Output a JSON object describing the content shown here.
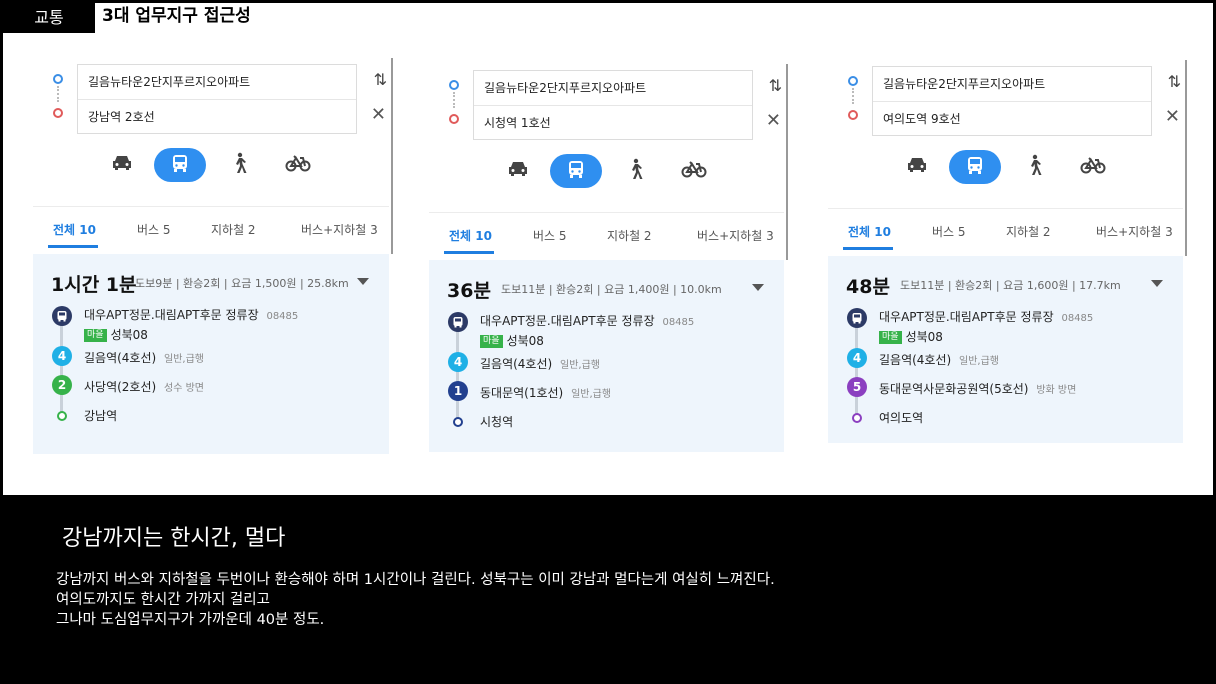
{
  "header": {
    "tag": "교통",
    "title": "3대 업무지구 접근성"
  },
  "panels": [
    {
      "origin": "길음뉴타운2단지푸르지오아파트",
      "destination": "강남역 2호선",
      "tabs": [
        "전체 10",
        "버스 5",
        "지하철 2",
        "버스+지하철 3"
      ],
      "time": "1시간 1분",
      "meta": "도보9분 | 환승2회 | 요금 1,500원 | 25.8km",
      "bus_stop": "대우APT정문.대림APT후문 정류장",
      "bus_stop_id": "08485",
      "bus_badge": "마을",
      "bus_route": "성북08",
      "legs": [
        {
          "num": "4",
          "color": "#1fb0e6",
          "station": "길음역(4호선)",
          "sub": "일반,급행"
        },
        {
          "num": "2",
          "color": "#36b24a",
          "station": "사당역(2호선)",
          "sub": "성수 방면"
        }
      ],
      "end_color": "#36b24a",
      "end_station": "강남역"
    },
    {
      "origin": "길음뉴타운2단지푸르지오아파트",
      "destination": "시청역 1호선",
      "tabs": [
        "전체 10",
        "버스 5",
        "지하철 2",
        "버스+지하철 3"
      ],
      "time": "36분",
      "meta": "도보11분 | 환승2회 | 요금 1,400원 | 10.0km",
      "bus_stop": "대우APT정문.대림APT후문 정류장",
      "bus_stop_id": "08485",
      "bus_badge": "마을",
      "bus_route": "성북08",
      "legs": [
        {
          "num": "4",
          "color": "#1fb0e6",
          "station": "길음역(4호선)",
          "sub": "일반,급행"
        },
        {
          "num": "1",
          "color": "#22408f",
          "station": "동대문역(1호선)",
          "sub": "일반,급행"
        }
      ],
      "end_color": "#22408f",
      "end_station": "시청역"
    },
    {
      "origin": "길음뉴타운2단지푸르지오아파트",
      "destination": "여의도역 9호선",
      "tabs": [
        "전체 10",
        "버스 5",
        "지하철 2",
        "버스+지하철 3"
      ],
      "time": "48분",
      "meta": "도보11분 | 환승2회 | 요금 1,600원 | 17.7km",
      "bus_stop": "대우APT정문.대림APT후문 정류장",
      "bus_stop_id": "08485",
      "bus_badge": "마을",
      "bus_route": "성북08",
      "legs": [
        {
          "num": "4",
          "color": "#1fb0e6",
          "station": "길음역(4호선)",
          "sub": "일반,급행"
        },
        {
          "num": "5",
          "color": "#8b3fc0",
          "station": "동대문역사문화공원역(5호선)",
          "sub": "방화 방면"
        }
      ],
      "end_color": "#8b3fc0",
      "end_station": "여의도역"
    }
  ],
  "bottom": {
    "heading": "강남까지는 한시간, 멀다",
    "lines": [
      "강남까지 버스와 지하철을 두번이나 환승해야 하며 1시간이나 걸린다. 성북구는 이미 강남과 멀다는게 여실히 느껴진다.",
      "여의도까지도 한시간 가까지 걸리고",
      "그나마 도심업무지구가 가까운데 40분 정도."
    ]
  },
  "colors": {
    "accent": "#2f8ff0",
    "bus_navy": "#2c3a66"
  }
}
